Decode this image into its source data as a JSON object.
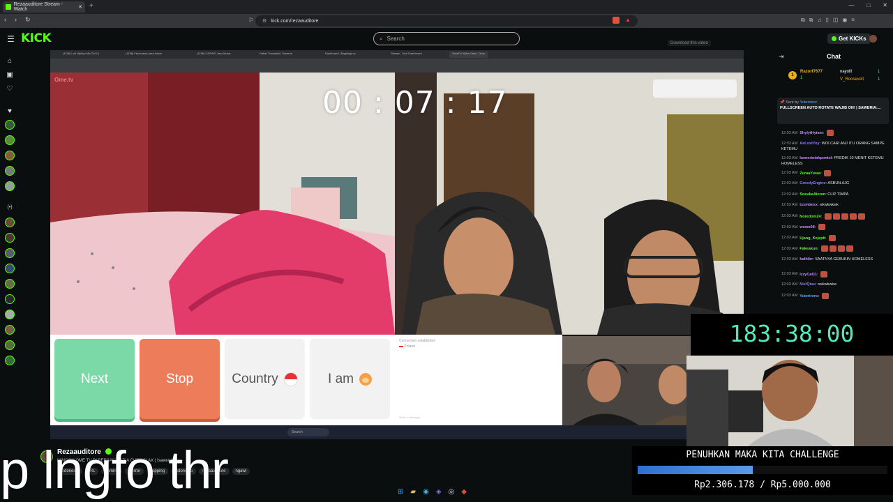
{
  "browser": {
    "tab_title": "Rezaauditore Stream - Watch",
    "new_tab": "+",
    "window_controls": [
      "—",
      "□",
      "✕"
    ],
    "url": "kick.com/rezaauditore"
  },
  "kick": {
    "logo": "KICK",
    "search_placeholder": "Search",
    "get_kicks": "Get KICKs"
  },
  "stream": {
    "inner_tabs": [
      "(1158) Lofi Hiphop Mix 2022 |",
      "(1158) Fenomena para tentar",
      "(1158) CASINO Jazz Music",
      "Daftar Transaksi | Saweria",
      "Dashboard | Bagibagi.co",
      "Stream - Kick Dashboard",
      "OmeTV Video Chat - Ome"
    ],
    "download_label": "Download this video",
    "ometv_logo": "Ome.tv",
    "timer": "00 : 07 : 17",
    "buttons": {
      "next": "Next",
      "stop": "Stop",
      "country": "Country",
      "iam": "I am"
    },
    "chat_status": "Connection established",
    "chat_location": "Poland",
    "chat_placeholder": "Write a message",
    "inner_search": "Search"
  },
  "chat": {
    "title": "Chat",
    "leaderboard": [
      {
        "rank": "1",
        "name": "Razorf7677",
        "count": "1"
      },
      {
        "rank": "",
        "name": "nayolll",
        "count": "1"
      },
      {
        "rank": "",
        "name": "V_Roosevelt",
        "count": "1"
      }
    ],
    "pinned_by": "Sent by",
    "pinned_user": "Yuterirenc",
    "pinned_text": "FULLSCREEN AUTO ROTATE WAJIB ON! | SAWERIA:...",
    "messages": [
      {
        "time": "12:03 AM",
        "user": "ShylytHytam",
        "text": "",
        "color": "#c58cff"
      },
      {
        "time": "12:03 AM",
        "user": "AeLostYoy",
        "text": "WOI CARI ANJ ITU ORANG SAMPE KETEMU",
        "color": "#8c7cff"
      },
      {
        "time": "12:03 AM",
        "user": "kemerintahpontol",
        "text": "PREDIK 10 MENIT KETEMU HOMELESS",
        "color": "#c58cff"
      },
      {
        "time": "12:03 AM",
        "user": "ZuraaYuraa",
        "text": "",
        "color": "#53fc18"
      },
      {
        "time": "12:03 AM",
        "user": "GreedyEngine",
        "text": "ASBUN AJG",
        "color": "#8c7cff"
      },
      {
        "time": "12:03 AM",
        "user": "SosukeAizzen",
        "text": "CLIP TIMPA",
        "color": "#53fc18"
      },
      {
        "time": "12:03 AM",
        "user": "txxmtmxx",
        "text": "wkwkwkwk",
        "color": "#c58cff"
      },
      {
        "time": "12:03 AM",
        "user": "Noredom24",
        "text": "",
        "color": "#53fc18"
      },
      {
        "time": "12:03 AM",
        "user": "wowo08",
        "text": "",
        "color": "#c58cff"
      },
      {
        "time": "12:03 AM",
        "user": "Ujang_Kejepit",
        "text": "",
        "color": "#53fc18"
      },
      {
        "time": "12:03 AM",
        "user": "Fakeakun",
        "text": "",
        "color": "#53fc18"
      },
      {
        "time": "12:03 AM",
        "user": "fadhilrr",
        "text": "SAATNYA GEBUKIN HOMELESS",
        "color": "#c58cff"
      },
      {
        "time": "12:03 AM",
        "user": "IzzyCat11",
        "text": "",
        "color": "#c58cff"
      },
      {
        "time": "12:03 AM",
        "user": "NielQiuu",
        "text": "owkwkwkw",
        "color": "#8c7cff"
      },
      {
        "time": "12:03 AM",
        "user": "Yuterirenc",
        "text": "",
        "color": "#5aa8ff"
      }
    ]
  },
  "overlays": {
    "countdown": "183:38:00",
    "challenge_title": "PENUHKAN MAKA KITA CHALLENGE",
    "challenge_amount": "Rp2.306.178 / Rp5.000.000",
    "challenge_progress": 0.4612
  },
  "channel": {
    "name": "Rezaauditore",
    "title": "MINGGU OME TV DI BERSAMA PRIA CURTISLAX | !sawer !hr",
    "tags": [
      "Indonesia",
      "IRL",
      "gaming",
      "Horror",
      "yapping",
      "Indonesia",
      "rezaauditore",
      "ngawi"
    ]
  },
  "caption": "p lngfo thr",
  "colors": {
    "kick_green": "#53fc18",
    "next_green": "#7bd9a8",
    "stop_orange": "#ec7c5a",
    "countdown_teal": "#57e6b8",
    "progress_blue": "#3a7fd9"
  }
}
